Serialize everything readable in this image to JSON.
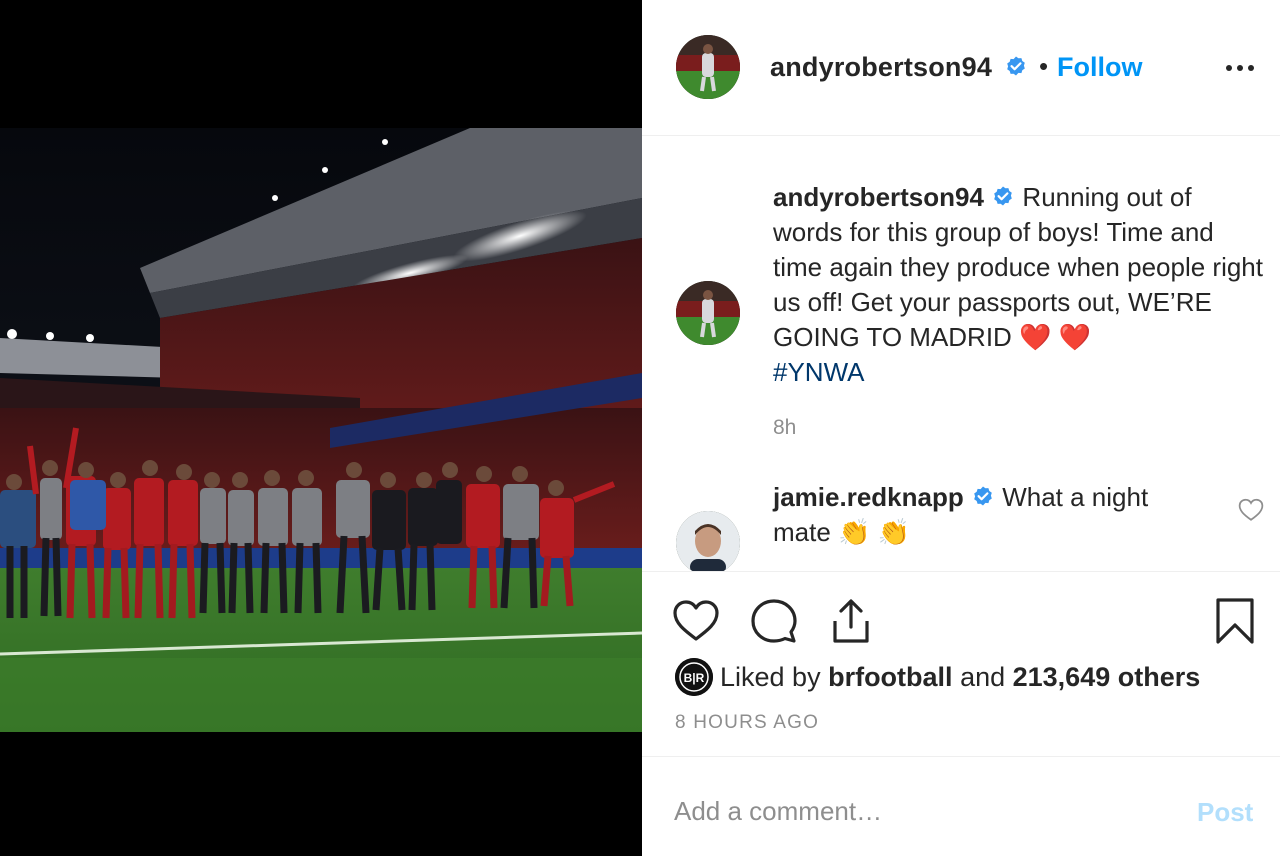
{
  "post": {
    "author": {
      "username": "andyrobertson94",
      "verified": true,
      "follow_label": "Follow",
      "separator": "•"
    },
    "caption": {
      "username": "andyrobertson94",
      "text": "Running out of words for this group of boys! Time and time again they produce when people right us off! Get your passports out, WE’RE GOING TO MADRID ❤️ ❤️",
      "hashtag": "#YNWA",
      "time": "8h"
    },
    "comments": [
      {
        "username": "jamie.redknapp",
        "verified": true,
        "text": "What a night mate 👏 👏"
      }
    ],
    "likes": {
      "prefix": "Liked by ",
      "liked_by": "brfootball",
      "middle": " and ",
      "count_text": "213,649 others",
      "liker_avatar_text": "B|R"
    },
    "posted_ago": "8 HOURS AGO",
    "add_comment": {
      "placeholder": "Add a comment…",
      "post_label": "Post"
    }
  },
  "icons": {
    "header_more": "more-options-icon",
    "verified": "verified-badge-icon",
    "like": "heart-icon",
    "comment": "comment-bubble-icon",
    "share": "share-icon",
    "save": "bookmark-icon",
    "comment_like": "small-heart-icon"
  },
  "colors": {
    "link_blue": "#0095f6",
    "hashtag_blue": "#00376b",
    "muted_gray": "#8e8e8e",
    "post_disabled": "#b2dffc",
    "text": "#262626"
  }
}
